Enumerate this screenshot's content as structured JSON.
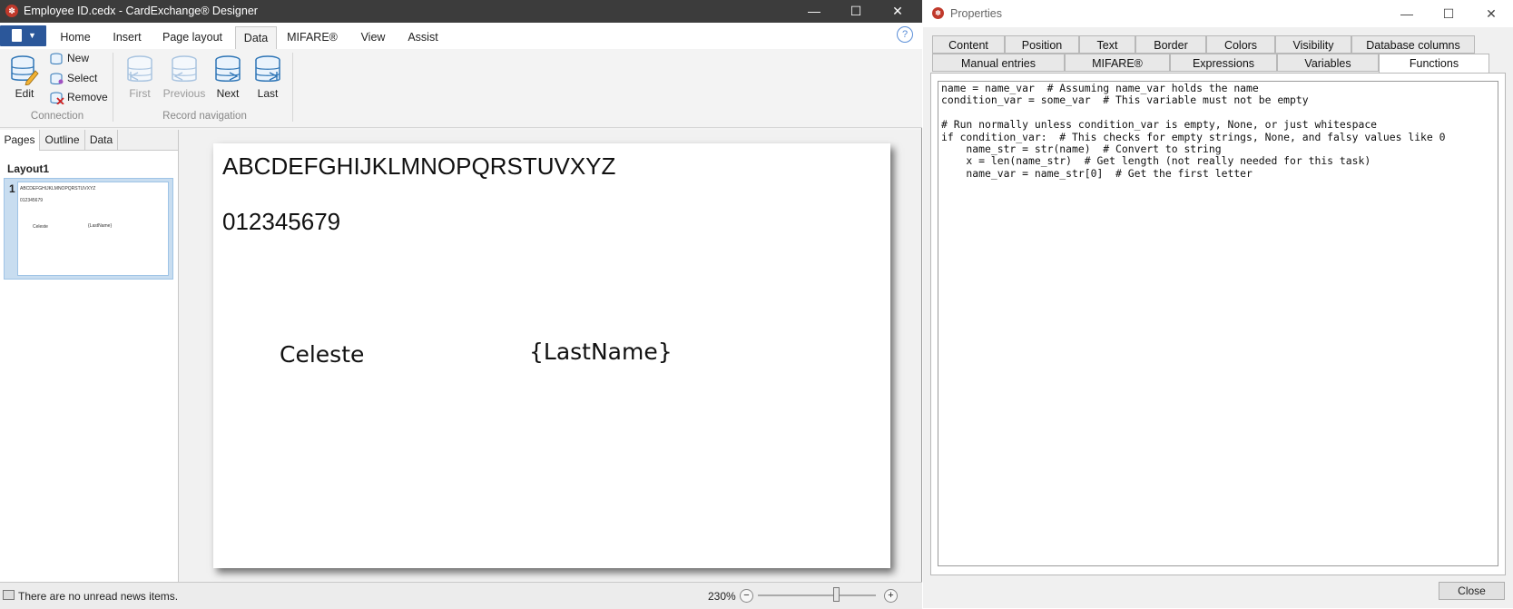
{
  "designer": {
    "title": "Employee ID.cedx - CardExchange® Designer",
    "ribbon_tabs": [
      "Home",
      "Insert",
      "Page layout",
      "Data",
      "MIFARE®",
      "View",
      "Assist"
    ],
    "active_tab": "Data",
    "connection": {
      "edit_label": "Edit",
      "new_label": "New",
      "select_label": "Select",
      "remove_label": "Remove",
      "group_label": "Connection"
    },
    "record_navigation": {
      "first_label": "First",
      "previous_label": "Previous",
      "next_label": "Next",
      "last_label": "Last",
      "group_label": "Record navigation"
    },
    "pane_tabs": [
      "Pages",
      "Outline",
      "Data"
    ],
    "layout_title": "Layout1",
    "page_number": "1",
    "card": {
      "alphabet": "ABCDEFGHIJKLMNOPQRSTUVXYZ",
      "digits": "012345679",
      "first_name": "Celeste",
      "last_name_field": "{LastName}"
    },
    "status": {
      "news": "There are no unread news items.",
      "zoom": "230%",
      "zoom_fraction": 0.66
    }
  },
  "properties": {
    "title": "Properties",
    "tabs_row1": [
      "Content",
      "Position",
      "Text",
      "Border",
      "Colors",
      "Visibility",
      "Database columns"
    ],
    "tabs_row2": [
      "Manual entries",
      "MIFARE®",
      "Expressions",
      "Variables",
      "Functions"
    ],
    "active_tab": "Functions",
    "code_lines": [
      "name = name_var  # Assuming name_var holds the name",
      "condition_var = some_var  # This variable must not be empty",
      "",
      "# Run normally unless condition_var is empty, None, or just whitespace",
      "if condition_var:  # This checks for empty strings, None, and falsy values like 0",
      "    name_str = str(name)  # Convert to string",
      "    x = len(name_str)  # Get length (not really needed for this task)",
      "    name_var = name_str[0]  # Get the first letter"
    ],
    "close_label": "Close"
  },
  "colors": {
    "file_button": "#2b579a",
    "titlebar": "#3c3c3c",
    "selection": "#c8ddf0"
  }
}
